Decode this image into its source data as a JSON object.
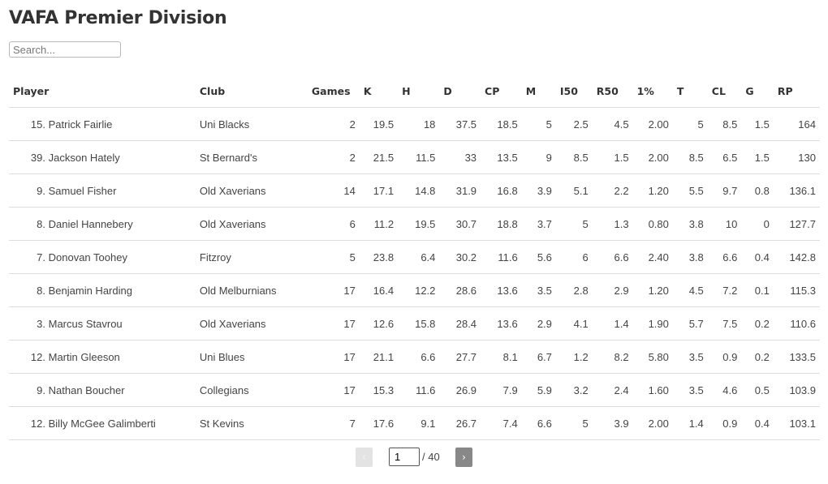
{
  "page": {
    "title": "VAFA Premier Division"
  },
  "search": {
    "placeholder": "Search...",
    "value": ""
  },
  "table": {
    "columns": [
      "Player",
      "Club",
      "Games",
      "K",
      "H",
      "D",
      "CP",
      "M",
      "I50",
      "R50",
      "1%",
      "T",
      "CL",
      "G",
      "RP"
    ],
    "rows": [
      {
        "rank": "15.",
        "player": "Patrick Fairlie",
        "club": "Uni Blacks",
        "games": "2",
        "k": "19.5",
        "h": "18",
        "d": "37.5",
        "cp": "18.5",
        "m": "5",
        "i50": "2.5",
        "r50": "4.5",
        "one_pct": "2.00",
        "t": "5",
        "cl": "8.5",
        "g": "1.5",
        "rp": "164"
      },
      {
        "rank": "39.",
        "player": "Jackson Hately",
        "club": "St Bernard's",
        "games": "2",
        "k": "21.5",
        "h": "11.5",
        "d": "33",
        "cp": "13.5",
        "m": "9",
        "i50": "8.5",
        "r50": "1.5",
        "one_pct": "2.00",
        "t": "8.5",
        "cl": "6.5",
        "g": "1.5",
        "rp": "130"
      },
      {
        "rank": "9.",
        "player": "Samuel Fisher",
        "club": "Old Xaverians",
        "games": "14",
        "k": "17.1",
        "h": "14.8",
        "d": "31.9",
        "cp": "16.8",
        "m": "3.9",
        "i50": "5.1",
        "r50": "2.2",
        "one_pct": "1.20",
        "t": "5.5",
        "cl": "9.7",
        "g": "0.8",
        "rp": "136.1"
      },
      {
        "rank": "8.",
        "player": "Daniel Hannebery",
        "club": "Old Xaverians",
        "games": "6",
        "k": "11.2",
        "h": "19.5",
        "d": "30.7",
        "cp": "18.8",
        "m": "3.7",
        "i50": "5",
        "r50": "1.3",
        "one_pct": "0.80",
        "t": "3.8",
        "cl": "10",
        "g": "0",
        "rp": "127.7"
      },
      {
        "rank": "7.",
        "player": "Donovan Toohey",
        "club": "Fitzroy",
        "games": "5",
        "k": "23.8",
        "h": "6.4",
        "d": "30.2",
        "cp": "11.6",
        "m": "5.6",
        "i50": "6",
        "r50": "6.6",
        "one_pct": "2.40",
        "t": "3.8",
        "cl": "6.6",
        "g": "0.4",
        "rp": "142.8"
      },
      {
        "rank": "8.",
        "player": "Benjamin Harding",
        "club": "Old Melburnians",
        "games": "17",
        "k": "16.4",
        "h": "12.2",
        "d": "28.6",
        "cp": "13.6",
        "m": "3.5",
        "i50": "2.8",
        "r50": "2.9",
        "one_pct": "1.20",
        "t": "4.5",
        "cl": "7.2",
        "g": "0.1",
        "rp": "115.3"
      },
      {
        "rank": "3.",
        "player": "Marcus Stavrou",
        "club": "Old Xaverians",
        "games": "17",
        "k": "12.6",
        "h": "15.8",
        "d": "28.4",
        "cp": "13.6",
        "m": "2.9",
        "i50": "4.1",
        "r50": "1.4",
        "one_pct": "1.90",
        "t": "5.7",
        "cl": "7.5",
        "g": "0.2",
        "rp": "110.6"
      },
      {
        "rank": "12.",
        "player": "Martin Gleeson",
        "club": "Uni Blues",
        "games": "17",
        "k": "21.1",
        "h": "6.6",
        "d": "27.7",
        "cp": "8.1",
        "m": "6.7",
        "i50": "1.2",
        "r50": "8.2",
        "one_pct": "5.80",
        "t": "3.5",
        "cl": "0.9",
        "g": "0.2",
        "rp": "133.5"
      },
      {
        "rank": "9.",
        "player": "Nathan Boucher",
        "club": "Collegians",
        "games": "17",
        "k": "15.3",
        "h": "11.6",
        "d": "26.9",
        "cp": "7.9",
        "m": "5.9",
        "i50": "3.2",
        "r50": "2.4",
        "one_pct": "1.60",
        "t": "3.5",
        "cl": "4.6",
        "g": "0.5",
        "rp": "103.9"
      },
      {
        "rank": "12.",
        "player": "Billy McGee Galimberti",
        "club": "St Kevins",
        "games": "7",
        "k": "17.6",
        "h": "9.1",
        "d": "26.7",
        "cp": "7.4",
        "m": "6.6",
        "i50": "5",
        "r50": "3.9",
        "one_pct": "2.00",
        "t": "1.4",
        "cl": "0.9",
        "g": "0.4",
        "rp": "103.1"
      }
    ]
  },
  "pagination": {
    "prev_icon": "‹",
    "next_icon": "›",
    "current_page": "1",
    "total_label": "/ 40"
  }
}
